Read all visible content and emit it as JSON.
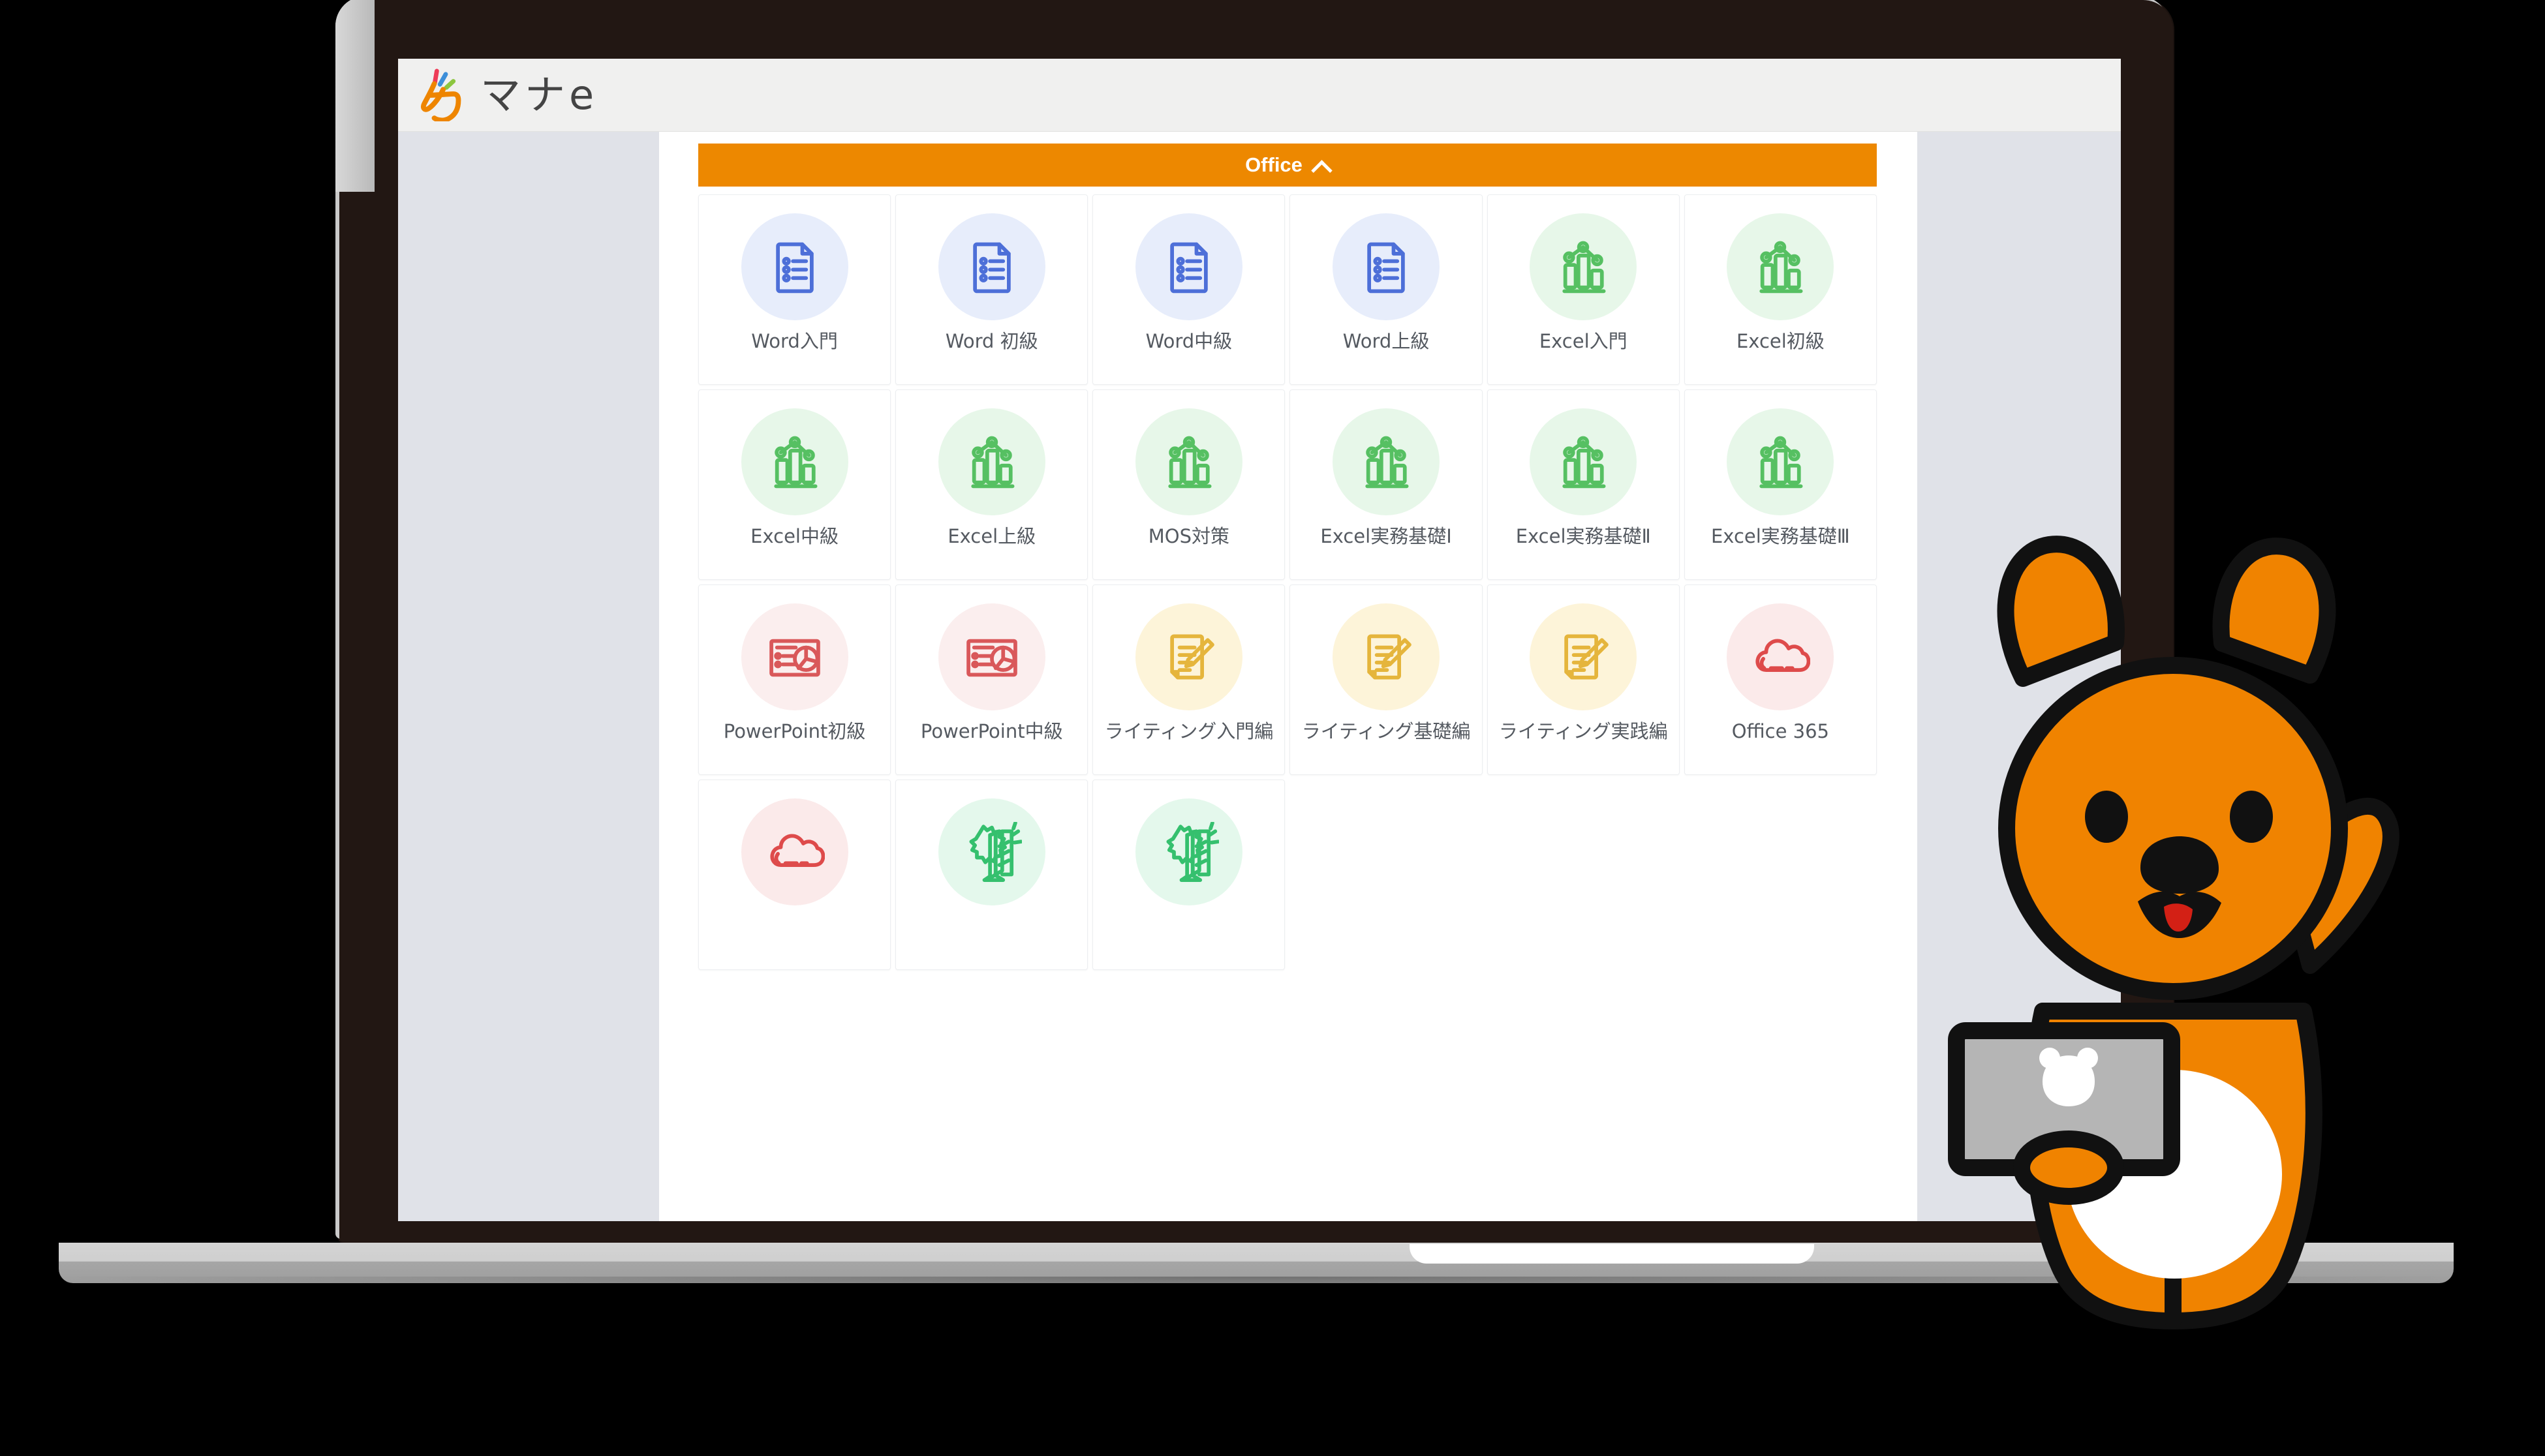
{
  "brand": {
    "logo_text": "マナe",
    "logo_icon": "mane-clap-icon",
    "accent_color": "#ED8800",
    "logo_accent_colors": [
      "#ee3b57",
      "#3d8fd9",
      "#8cc63f"
    ]
  },
  "category": {
    "label": "Office",
    "toggle_icon": "chevron-up-icon",
    "expanded": true,
    "banner_color": "#ED8800"
  },
  "courses": [
    {
      "label": "Word入門",
      "icon": "document-list-icon",
      "icon_color": "#4d6fd8",
      "circle_color": "#e7edfb"
    },
    {
      "label": "Word 初級",
      "icon": "document-list-icon",
      "icon_color": "#4d6fd8",
      "circle_color": "#e7edfb"
    },
    {
      "label": "Word中級",
      "icon": "document-list-icon",
      "icon_color": "#4d6fd8",
      "circle_color": "#e7edfb"
    },
    {
      "label": "Word上級",
      "icon": "document-list-icon",
      "icon_color": "#4d6fd8",
      "circle_color": "#e7edfb"
    },
    {
      "label": "Excel入門",
      "icon": "bar-chart-icon",
      "icon_color": "#56c062",
      "circle_color": "#e7f7e9"
    },
    {
      "label": "Excel初級",
      "icon": "bar-chart-icon",
      "icon_color": "#56c062",
      "circle_color": "#e7f7e9"
    },
    {
      "label": "Excel中級",
      "icon": "bar-chart-icon",
      "icon_color": "#56c062",
      "circle_color": "#e7f7e9"
    },
    {
      "label": "Excel上級",
      "icon": "bar-chart-icon",
      "icon_color": "#56c062",
      "circle_color": "#e7f7e9"
    },
    {
      "label": "MOS対策",
      "icon": "bar-chart-icon",
      "icon_color": "#56c062",
      "circle_color": "#e7f7e9"
    },
    {
      "label": "Excel実務基礎Ⅰ",
      "icon": "bar-chart-icon",
      "icon_color": "#56c062",
      "circle_color": "#e7f7e9"
    },
    {
      "label": "Excel実務基礎Ⅱ",
      "icon": "bar-chart-icon",
      "icon_color": "#56c062",
      "circle_color": "#e7f7e9"
    },
    {
      "label": "Excel実務基礎Ⅲ",
      "icon": "bar-chart-icon",
      "icon_color": "#56c062",
      "circle_color": "#e7f7e9"
    },
    {
      "label": "PowerPoint初級",
      "icon": "slide-piechart-icon",
      "icon_color": "#d9585a",
      "circle_color": "#fbeeee"
    },
    {
      "label": "PowerPoint中級",
      "icon": "slide-piechart-icon",
      "icon_color": "#d9585a",
      "circle_color": "#fbeeee"
    },
    {
      "label": "ライティング入門編",
      "icon": "pencil-doc-icon",
      "icon_color": "#e5b53c",
      "circle_color": "#fdf4d9"
    },
    {
      "label": "ライティング基礎編",
      "icon": "pencil-doc-icon",
      "icon_color": "#e5b53c",
      "circle_color": "#fdf4d9"
    },
    {
      "label": "ライティング実践編",
      "icon": "pencil-doc-icon",
      "icon_color": "#e5b53c",
      "circle_color": "#fdf4d9"
    },
    {
      "label": "Office 365",
      "icon": "cloud-icon",
      "icon_color": "#de4b4b",
      "circle_color": "#fbeaea"
    },
    {
      "label": "",
      "icon": "cloud-icon",
      "icon_color": "#de4b4b",
      "circle_color": "#fbeaea"
    },
    {
      "label": "",
      "icon": "gear-book-icon",
      "icon_color": "#35c06e",
      "circle_color": "#e4f8ec"
    },
    {
      "label": "",
      "icon": "gear-book-icon",
      "icon_color": "#35c06e",
      "circle_color": "#e4f8ec"
    }
  ],
  "mascot": {
    "name": "orange-bear-mascot",
    "body_color": "#F08300",
    "belly_color": "#FFFFFF",
    "outline_color": "#111111",
    "tongue_color": "#D32015",
    "laptop_screen_color": "#B5B5B5",
    "laptop_logo_icon": "bear-face-icon"
  },
  "device": {
    "name": "laptop-mockup",
    "bezel_color": "#221713",
    "base_color": "#CFCFCF",
    "sidebar_color": "#E0E2E8"
  }
}
